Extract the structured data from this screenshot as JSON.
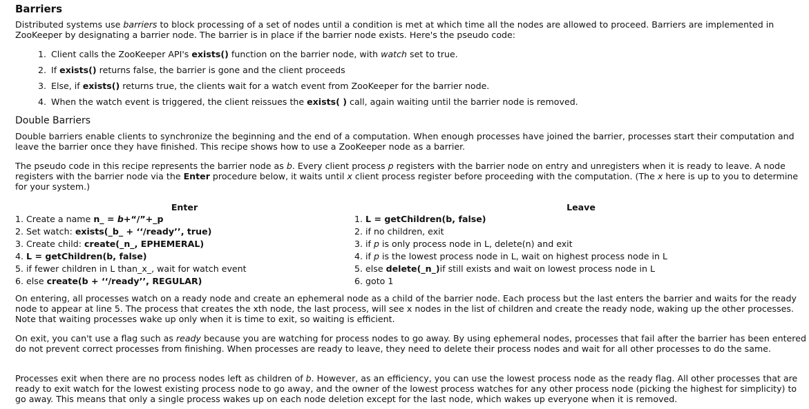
{
  "title": "Barriers",
  "intro": [
    [
      "Distributed systems use ",
      ""
    ],
    [
      "barriers",
      "i"
    ],
    [
      " to block processing of a set of nodes until a condition is met at which time all the nodes are allowed to proceed. Barriers are implemented in ZooKeeper by designating a barrier node. The barrier is in place if the barrier node exists. Here's the pseudo code:",
      ""
    ]
  ],
  "steps": [
    [
      [
        "Client calls the ZooKeeper API's ",
        ""
      ],
      [
        "exists()",
        "b"
      ],
      [
        " function on the barrier node, with ",
        ""
      ],
      [
        "watch",
        "i"
      ],
      [
        " set to true.",
        ""
      ]
    ],
    [
      [
        "If ",
        ""
      ],
      [
        "exists()",
        "b"
      ],
      [
        " returns false, the barrier is gone and the client proceeds",
        ""
      ]
    ],
    [
      [
        "Else, if ",
        ""
      ],
      [
        "exists()",
        "b"
      ],
      [
        " returns true, the clients wait for a watch event from ZooKeeper for the barrier node.",
        ""
      ]
    ],
    [
      [
        "When the watch event is triggered, the client reissues the ",
        ""
      ],
      [
        "exists( )",
        "b"
      ],
      [
        " call, again waiting until the barrier node is removed.",
        ""
      ]
    ]
  ],
  "step_numbers": [
    "1.",
    "2.",
    "3.",
    "4."
  ],
  "double_title": "Double Barriers",
  "double_p1": [
    [
      "Double barriers enable clients to synchronize the beginning and the end of a computation. When enough processes have joined the barrier, processes start their computation and leave the barrier once they have finished. This recipe shows how to use a ZooKeeper node as a barrier.",
      ""
    ]
  ],
  "double_p2": [
    [
      "The pseudo code in this recipe represents the barrier node as ",
      ""
    ],
    [
      "b",
      "i"
    ],
    [
      ". Every client process ",
      ""
    ],
    [
      "p",
      "i"
    ],
    [
      " registers with the barrier node on entry and unregisters when it is ready to leave. A node registers with the barrier node via the ",
      ""
    ],
    [
      "Enter",
      "b"
    ],
    [
      " procedure below, it waits until ",
      ""
    ],
    [
      "x",
      "i"
    ],
    [
      " client process register before proceeding with the computation. (The ",
      ""
    ],
    [
      "x",
      "i"
    ],
    [
      " here is up to you to determine for your system.)",
      ""
    ]
  ],
  "enter": {
    "header": "Enter",
    "rows": [
      [
        [
          "1. Create a name ",
          ""
        ],
        [
          "n_ = ",
          "b"
        ],
        [
          "b",
          "bi"
        ],
        [
          "+“/”+_p",
          "b"
        ]
      ],
      [
        [
          "2. Set watch: ",
          ""
        ],
        [
          "exists(_b_ + ‘‘/ready’’, true)",
          "b"
        ]
      ],
      [
        [
          "3. Create child: ",
          ""
        ],
        [
          "create(_n_, EPHEMERAL)",
          "b"
        ]
      ],
      [
        [
          "4. ",
          ""
        ],
        [
          "L = getChildren(b, false)",
          "b"
        ]
      ],
      [
        [
          "5. if fewer children in L than_x_, wait for watch event",
          ""
        ]
      ],
      [
        [
          "6. else ",
          ""
        ],
        [
          "create(b + ‘‘/ready’’, REGULAR)",
          "b"
        ]
      ]
    ]
  },
  "leave": {
    "header": "Leave",
    "rows": [
      [
        [
          "1. ",
          ""
        ],
        [
          "L = getChildren(b, false)",
          "b"
        ]
      ],
      [
        [
          "2. if no children, exit",
          ""
        ]
      ],
      [
        [
          "3. if ",
          ""
        ],
        [
          "p",
          "i"
        ],
        [
          " is only process node in L, delete(n) and exit",
          ""
        ]
      ],
      [
        [
          "4. if ",
          ""
        ],
        [
          "p",
          "i"
        ],
        [
          " is the lowest process node in L, wait on highest process node in L",
          ""
        ]
      ],
      [
        [
          "5. else ",
          ""
        ],
        [
          "delete(_n_)",
          "b"
        ],
        [
          "if still exists and wait on lowest process node in L",
          ""
        ]
      ],
      [
        [
          "6. goto 1",
          ""
        ]
      ]
    ]
  },
  "p_enter": [
    [
      "On entering, all processes watch on a ready node and create an ephemeral node as a child of the barrier node. Each process but the last enters the barrier and waits for the ready node to appear at line 5. The process that creates the xth node, the last process, will see x nodes in the list of children and create the ready node, waking up the other processes. Note that waiting processes wake up only when it is time to exit, so waiting is efficient.",
      ""
    ]
  ],
  "p_exit": [
    [
      "On exit, you can't use a flag such as ",
      ""
    ],
    [
      "ready",
      "i"
    ],
    [
      " because you are watching for process nodes to go away. By using ephemeral nodes, processes that fail after the barrier has been entered do not prevent correct processes from finishing. When processes are ready to leave, they need to delete their process nodes and wait for all other processes to do the same.",
      ""
    ]
  ],
  "p_lowest": [
    [
      "Processes exit when there are no process nodes left as children of ",
      ""
    ],
    [
      "b",
      "i"
    ],
    [
      ". However, as an efficiency, you can use the lowest process node as the ready flag. All other processes that are ready to exit watch for the lowest existing process node to go away, and the owner of the lowest process watches for any other process node (picking the highest for simplicity) to go away. This means that only a single process wakes up on each node deletion except for the last node, which wakes up everyone when it is removed.",
      ""
    ]
  ]
}
